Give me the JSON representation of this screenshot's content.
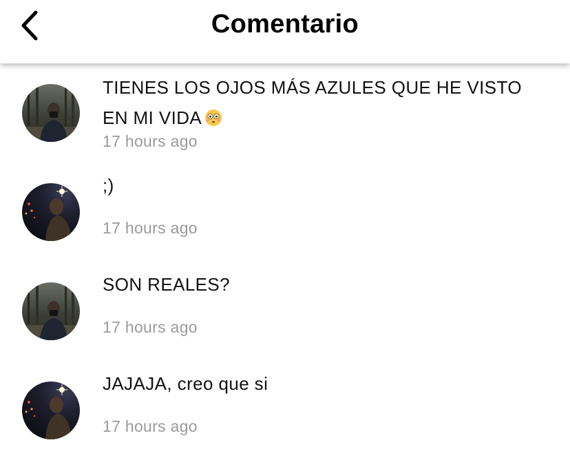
{
  "header": {
    "title": "Comentario",
    "back_icon": "chevron-left-icon"
  },
  "colors": {
    "text": "#111111",
    "timestamp": "#9a9a9a",
    "background": "#ffffff"
  },
  "comments": [
    {
      "text": "TIENES LOS OJOS MÁS AZULES QUE HE VISTO EN MI VIDA",
      "emoji": "flushed-face-emoji",
      "time": "17 hours ago",
      "avatar": "avatar-forest"
    },
    {
      "text": ";)",
      "time": "17 hours ago",
      "avatar": "avatar-night-lights"
    },
    {
      "text": "SON REALES?",
      "time": "17 hours ago",
      "avatar": "avatar-forest"
    },
    {
      "text": "JAJAJA, creo que si",
      "time": "17 hours ago",
      "avatar": "avatar-night-lights"
    }
  ]
}
